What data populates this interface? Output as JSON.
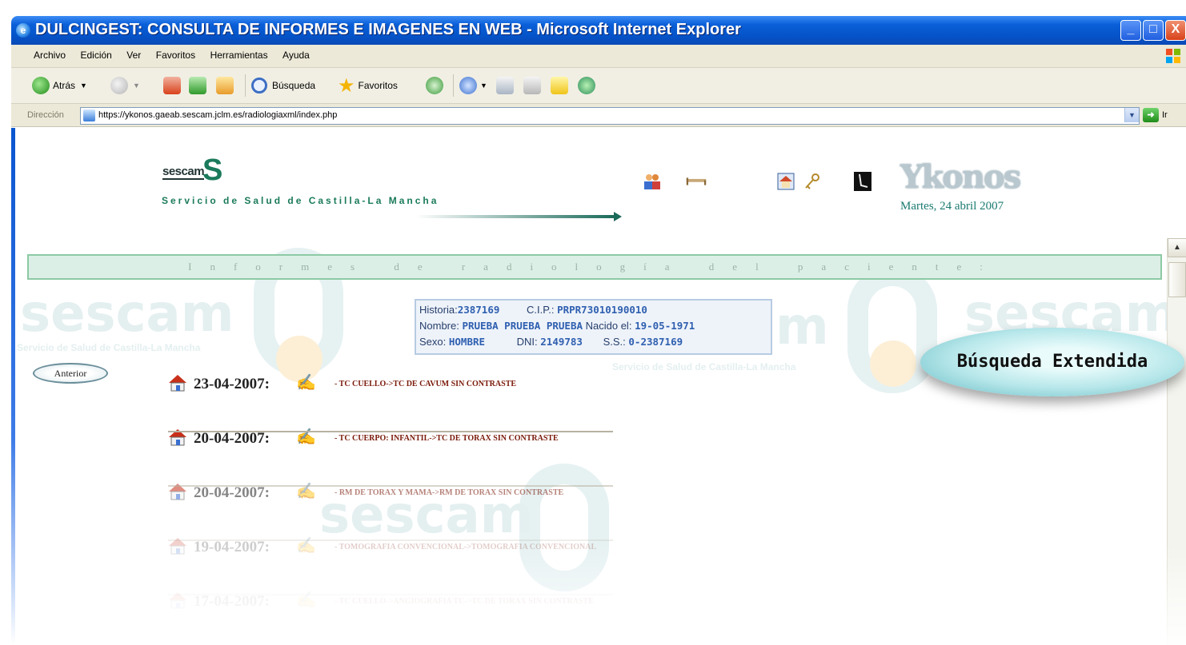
{
  "window": {
    "title": "DULCINGEST: CONSULTA DE INFORMES E IMAGENES EN WEB - Microsoft Internet Explorer",
    "minimize": "_",
    "maximize": "□",
    "close": "X"
  },
  "menu": [
    "Archivo",
    "Edición",
    "Ver",
    "Favoritos",
    "Herramientas",
    "Ayuda"
  ],
  "toolbar": {
    "back_label": "Atrás",
    "search_label": "Búsqueda",
    "favorites_label": "Favoritos"
  },
  "address": {
    "label": "Dirección",
    "url": "https://ykonos.gaeab.sescam.jclm.es/radiologiaxml/index.php",
    "go_label": "Ir"
  },
  "page": {
    "logo_word": "sescam",
    "logo_glyph": "S",
    "org_name": "Servicio de Salud de Castilla-La Mancha",
    "brand": "Ykonos",
    "date": "Martes, 24 abril 2007",
    "banner": "Informes de radiología del paciente:",
    "watermark_word": "sescam",
    "watermark_sub": "Servicio de Salud de Castilla-La Mancha",
    "watermark_fragment": "m"
  },
  "patient": {
    "historia_label": "Historia:",
    "historia": "2387169",
    "cip_label": "C.I.P.:",
    "cip": "PRPR73010190010",
    "nombre_label": "Nombre:",
    "nombre": "PRUEBA PRUEBA PRUEBA",
    "nacido_label": "Nacido el:",
    "nacido": "19-05-1971",
    "sexo_label": "Sexo:",
    "sexo": "HOMBRE",
    "dni_label": "DNI:",
    "dni": "2149783",
    "ss_label": "S.S.:",
    "ss": "0-2387169"
  },
  "buttons": {
    "anterior": "Anterior",
    "busqueda": "Búsqueda Extendida"
  },
  "reports": [
    {
      "date": "23-04-2007:",
      "desc": "- TC CUELLO->TC DE CAVUM SIN CONTRASTE"
    },
    {
      "date": "20-04-2007:",
      "desc": "- TC CUERPO: INFANTIL->TC DE TORAX SIN CONTRASTE"
    },
    {
      "date": "20-04-2007:",
      "desc": "- RM DE TORAX Y MAMA->RM DE TORAX SIN CONTRASTE"
    },
    {
      "date": "19-04-2007:",
      "desc": "- TOMOGRAFIA CONVENCIONAL->TOMOGRAFIA CONVENCIONAL"
    },
    {
      "date": "17-04-2007:",
      "desc": "- TC CUELLO->ANGIOGRAFIA TC->TC DE TORAX SIN CONTRASTE"
    }
  ],
  "report_opacity": [
    1,
    1,
    0.55,
    0.22,
    0.1
  ],
  "colors": {
    "titlebar": "#0553c8",
    "accent_green": "#1a7a5b",
    "banner_bg": "#dcefe6",
    "report_text": "#7a1a0a",
    "patient_value": "#2f5fb0"
  }
}
